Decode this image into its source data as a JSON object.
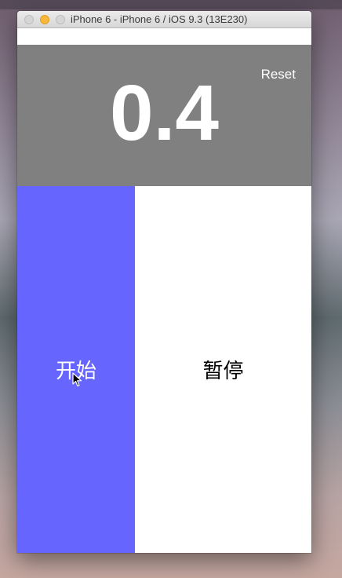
{
  "window": {
    "title": "iPhone 6 - iPhone 6 / iOS 9.3 (13E230)"
  },
  "stopwatch": {
    "time": "0.4",
    "reset_label": "Reset",
    "start_label": "开始",
    "pause_label": "暂停"
  },
  "colors": {
    "display_bg": "#808080",
    "start_bg": "#6666ff",
    "pause_bg": "#ffffff"
  },
  "icons": [
    "traffic-close-icon",
    "traffic-minimize-icon",
    "traffic-zoom-icon",
    "mouse-cursor-icon"
  ]
}
